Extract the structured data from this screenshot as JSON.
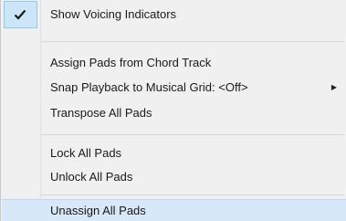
{
  "menu": {
    "items": [
      {
        "label": "Show Voicing Indicators",
        "checked": true
      },
      {
        "label": "Assign Pads from Chord Track"
      },
      {
        "label": "Snap Playback to Musical Grid: <Off>",
        "submenu": true
      },
      {
        "label": "Transpose All Pads"
      },
      {
        "label": "Lock All Pads"
      },
      {
        "label": "Unlock All Pads"
      },
      {
        "label": "Unassign All Pads",
        "highlighted": true
      }
    ],
    "submenu_arrow": "▶",
    "check_icon": "checkmark-icon"
  }
}
